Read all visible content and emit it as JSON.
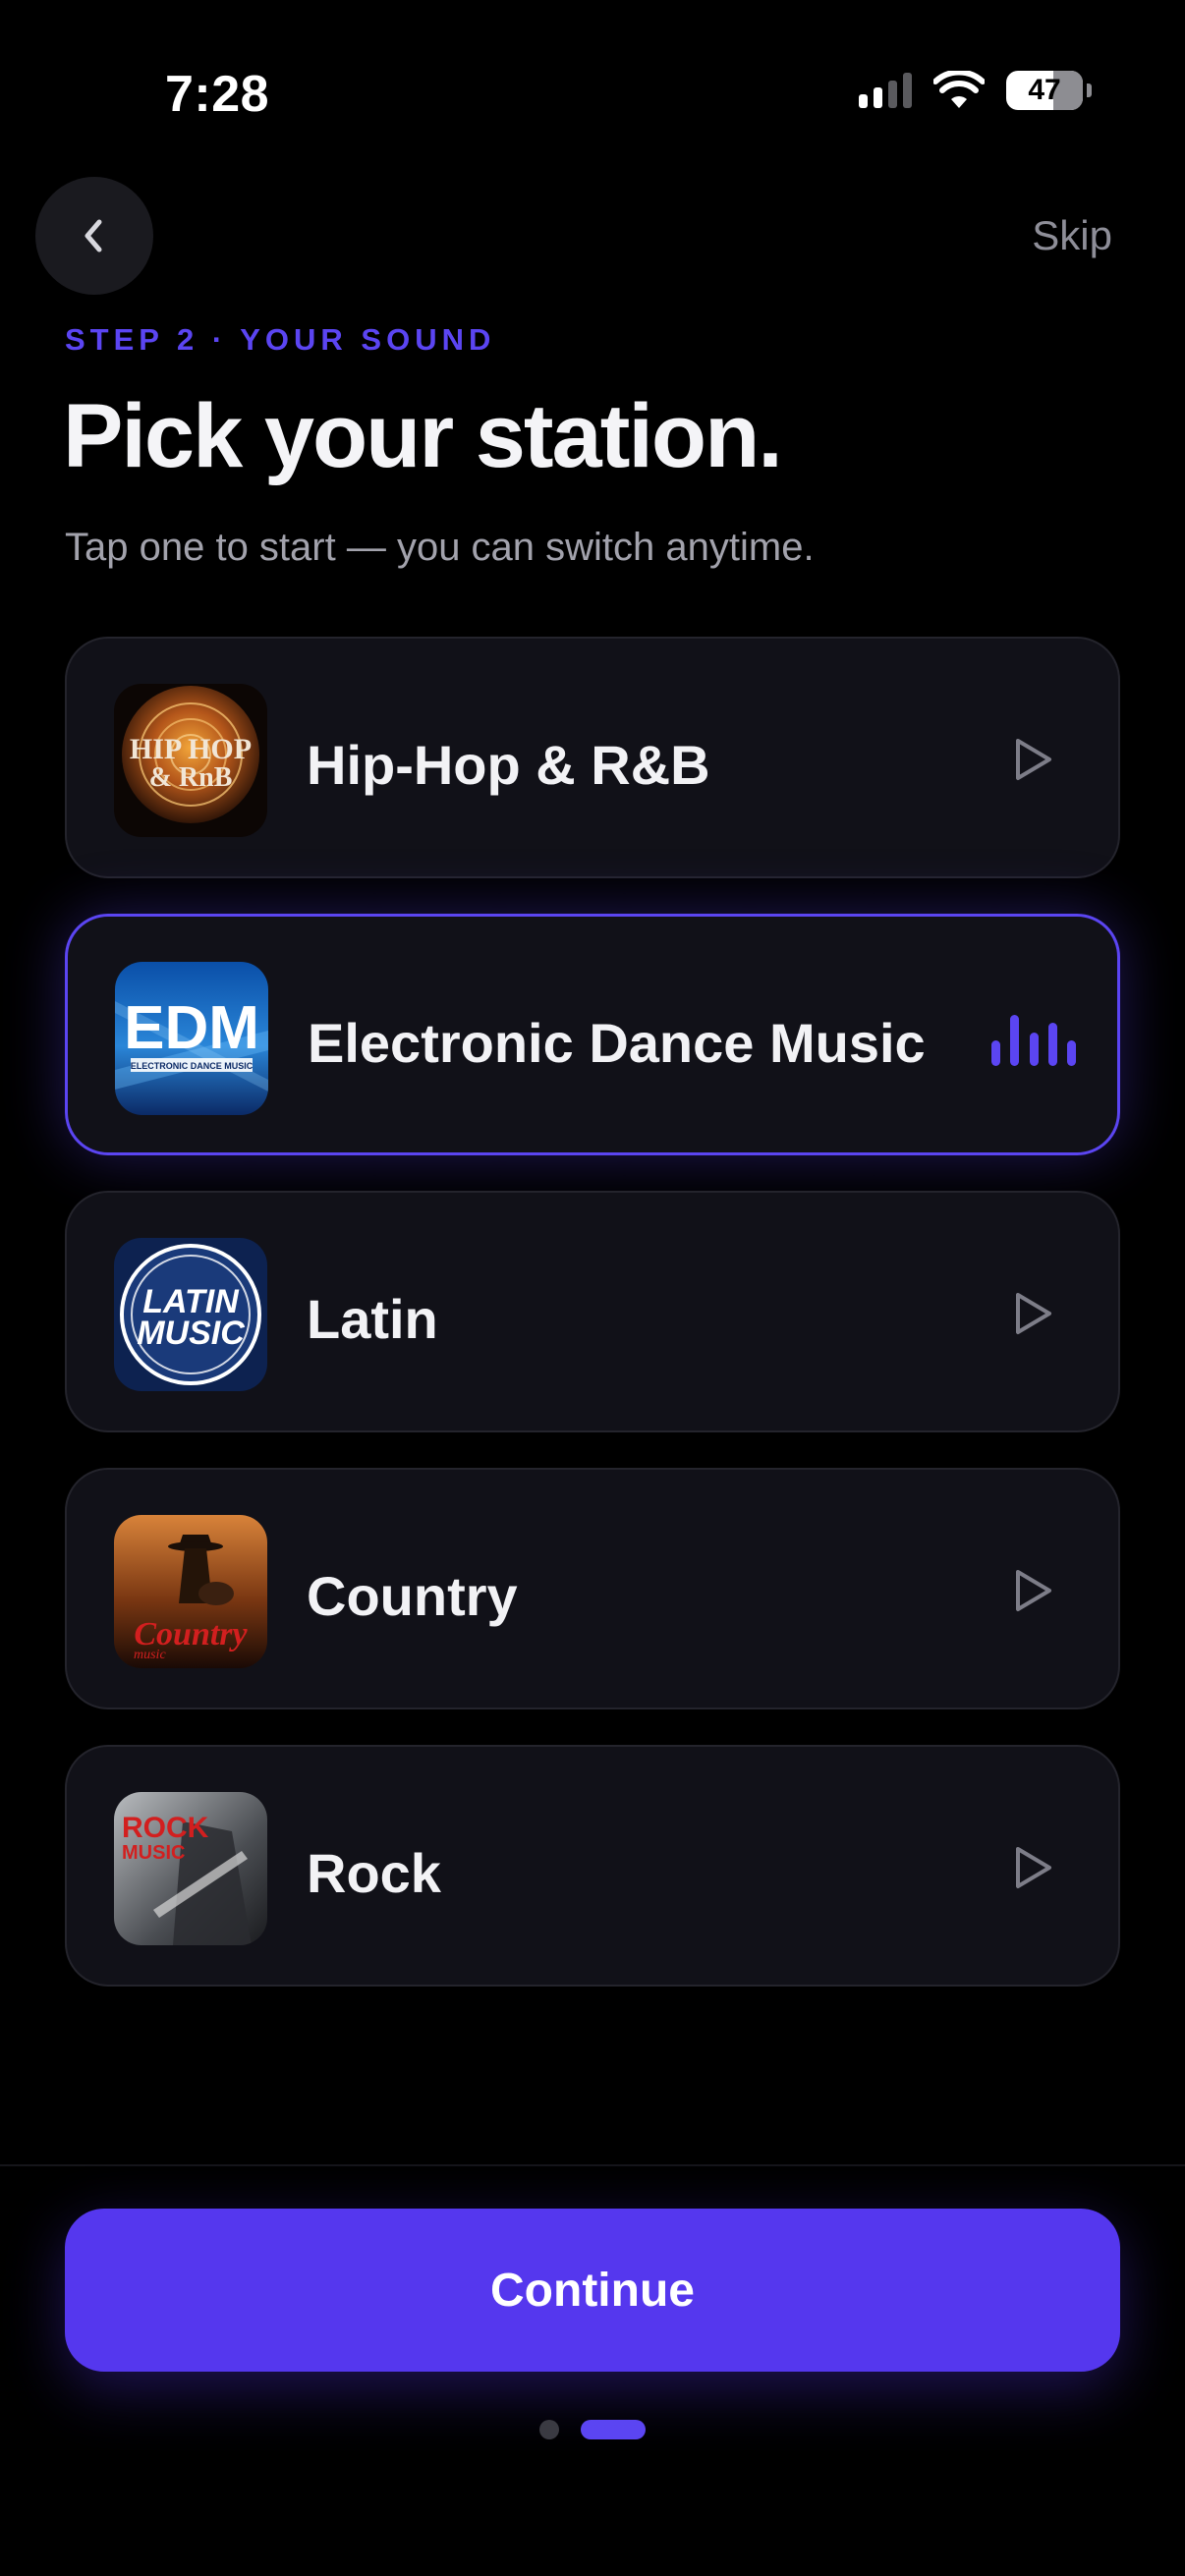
{
  "status_bar": {
    "time": "7:28",
    "battery": "47"
  },
  "nav": {
    "skip_label": "Skip"
  },
  "header": {
    "step_label": "STEP 2 · YOUR SOUND",
    "title": "Pick your station.",
    "subtitle": "Tap one to start — you can switch anytime."
  },
  "stations": [
    {
      "name": "Hip-Hop & R&B",
      "art_text_line1": "HIP HOP",
      "art_text_line2": "& RnB",
      "state": "idle"
    },
    {
      "name": "Electronic Dance Music",
      "art_text_line1": "EDM",
      "art_text_line2": "ELECTRONIC DANCE MUSIC",
      "state": "playing"
    },
    {
      "name": "Latin",
      "art_text_line1": "LATIN",
      "art_text_line2": "MUSIC",
      "state": "idle"
    },
    {
      "name": "Country",
      "art_text_line1": "Country",
      "art_text_line2": "music",
      "state": "idle"
    },
    {
      "name": "Rock",
      "art_text_line1": "ROCK",
      "art_text_line2": "MUSIC",
      "state": "idle"
    }
  ],
  "footer": {
    "continue_label": "Continue",
    "pager": {
      "current": 2,
      "total": 2
    }
  },
  "colors": {
    "accent": "#5b45f2",
    "background": "#000000",
    "card": "#111118"
  },
  "icons": {
    "back": "chevron-left-icon",
    "play": "play-icon",
    "playing": "equalizer-icon"
  }
}
